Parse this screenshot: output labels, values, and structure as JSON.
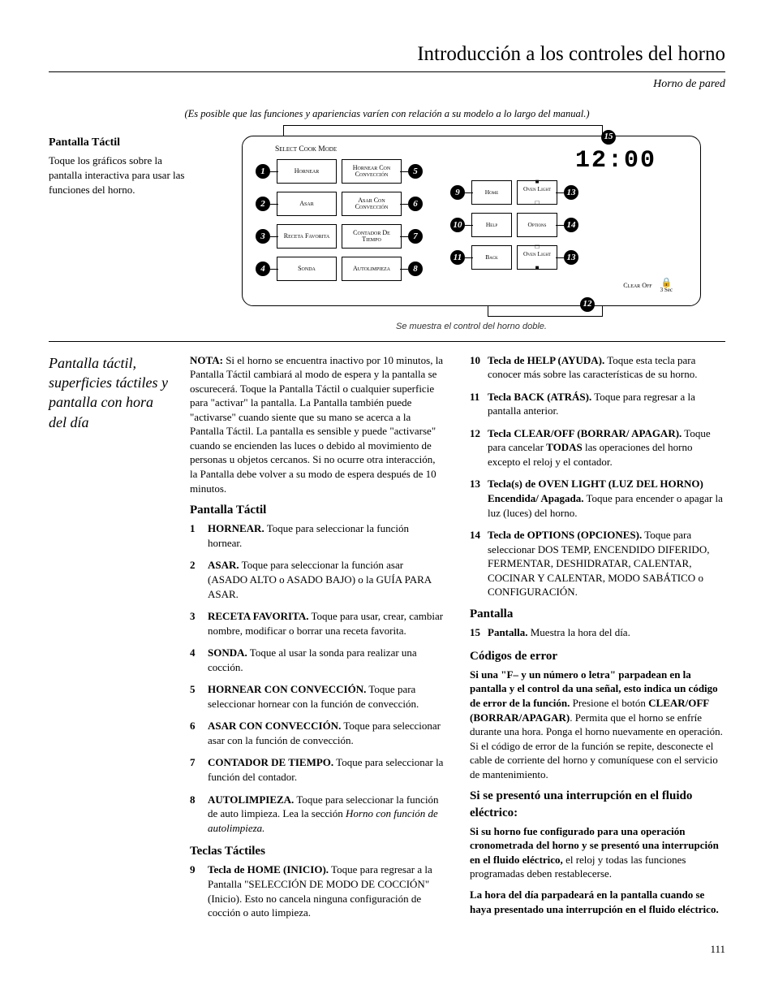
{
  "page_title": "Introducción a los controles del horno",
  "subtitle": "Horno de pared",
  "disclaimer": "(Es posible que las funciones y apariencias varíen con relación a su modelo a lo largo del manual.)",
  "intro": {
    "heading": "Pantalla Táctil",
    "body": "Toque los gráficos sobre la pantalla interactiva para usar las funciones del horno."
  },
  "diagram": {
    "select_cook_mode": "Select Cook Mode",
    "mode_buttons": [
      {
        "n": "1",
        "label": "Hornear"
      },
      {
        "n": "2",
        "label": "Asar"
      },
      {
        "n": "3",
        "label": "Receta Favorita"
      },
      {
        "n": "4",
        "label": "Sonda"
      },
      {
        "n": "5",
        "label": "Hornear Con Convección"
      },
      {
        "n": "6",
        "label": "Asar Con Convección"
      },
      {
        "n": "7",
        "label": "Contador De Tiempo"
      },
      {
        "n": "8",
        "label": "Autolimpieza"
      }
    ],
    "clock": "12:00",
    "keys": [
      {
        "n": "9",
        "label": "Home"
      },
      {
        "n": "10",
        "label": "Help"
      },
      {
        "n": "11",
        "label": "Back"
      },
      {
        "n": "13a",
        "label": "Oven Light",
        "on": true
      },
      {
        "n": "14",
        "label": "Options"
      },
      {
        "n": "13b",
        "label": "Oven Light",
        "on": false
      }
    ],
    "clear_off": "Clear Off",
    "lock_sec": "3 Sec",
    "callout_15": "15",
    "callout_12": "12",
    "caption": "Se muestra el control del horno doble."
  },
  "side_heading": "Pantalla táctil, superficies táctiles y pantalla con hora del día",
  "nota_label": "NOTA:",
  "nota_body": " Si el horno se encuentra inactivo por 10 minutos, la Pantalla Táctil cambiará al modo de espera y la pantalla se oscurecerá. Toque la Pantalla Táctil o cualquier superficie para \"activar\" la pantalla. La Pantalla también puede \"activarse\" cuando siente que su mano se acerca a la Pantalla Táctil. La pantalla es sensible y puede \"activarse\" cuando se encienden las luces o debido al movimiento de personas u objetos cercanos. Si no ocurre otra interacción, la Pantalla debe volver a su modo de espera después de 10 minutos.",
  "pt_heading": "Pantalla Táctil",
  "pt_items": [
    {
      "n": "1",
      "b": "HORNEAR.",
      "t": " Toque para seleccionar la función hornear."
    },
    {
      "n": "2",
      "b": "ASAR.",
      "t": " Toque para seleccionar la función asar (ASADO ALTO o ASADO BAJO) o la GUÍA PARA ASAR."
    },
    {
      "n": "3",
      "b": "RECETA FAVORITA.",
      "t": " Toque para usar, crear, cambiar nombre, modificar o borrar una receta favorita."
    },
    {
      "n": "4",
      "b": "SONDA.",
      "t": " Toque al usar la sonda para realizar una cocción."
    },
    {
      "n": "5",
      "b": "HORNEAR CON CONVECCIÓN.",
      "t": " Toque para seleccionar hornear con la función de convección."
    },
    {
      "n": "6",
      "b": "ASAR CON CONVECCIÓN.",
      "t": " Toque para seleccionar asar con la función de convección."
    },
    {
      "n": "7",
      "b": "CONTADOR DE TIEMPO.",
      "t": " Toque para seleccionar la función del contador."
    },
    {
      "n": "8",
      "b": "AUTOLIMPIEZA.",
      "t": " Toque para seleccionar la función de auto limpieza. Lea la sección ",
      "i": "Horno con función de autolimpieza."
    }
  ],
  "tt_heading": "Teclas Táctiles",
  "tt_items": [
    {
      "n": "9",
      "b": "Tecla de HOME (INICIO).",
      "t": " Toque para regresar a la Pantalla \"SELECCIÓN DE MODO DE COCCIÓN\" (Inicio). Esto no cancela ninguna configuración de cocción o auto limpieza."
    },
    {
      "n": "10",
      "b": "Tecla de HELP (AYUDA).",
      "t": " Toque esta tecla para conocer más sobre las características de su horno."
    },
    {
      "n": "11",
      "b": "Tecla BACK (ATRÁS).",
      "t": " Toque para regresar a la pantalla anterior."
    },
    {
      "n": "12",
      "b": "Tecla CLEAR/OFF (BORRAR/ APAGAR).",
      "t": " Toque para cancelar ",
      "b2": "TODAS",
      "t2": " las operaciones del horno excepto el reloj y el contador."
    },
    {
      "n": "13",
      "b": "Tecla(s) de OVEN LIGHT (LUZ DEL HORNO) Encendida/ Apagada.",
      "t": " Toque para encender o apagar la luz (luces) del horno."
    },
    {
      "n": "14",
      "b": "Tecla de OPTIONS (OPCIONES).",
      "t": " Toque para seleccionar DOS TEMP, ENCENDIDO DIFERIDO, FERMENTAR, DESHIDRATAR, CALENTAR, COCINAR Y CALENTAR, MODO SABÁTICO o CONFIGURACIÓN."
    }
  ],
  "pantalla_heading": "Pantalla",
  "pantalla_item": {
    "n": "15",
    "b": "Pantalla.",
    "t": " Muestra la hora del día."
  },
  "error_heading": "Códigos de error",
  "error_b1": "Si una \"F– y un número o letra\" parpadean en la pantalla y el control da una señal, esto indica un código de error de la función.",
  "error_t1": " Presione el botón ",
  "error_b2": "CLEAR/OFF (BORRAR/APAGAR)",
  "error_t2": ". Permita que el horno se enfríe durante una hora. Ponga el horno nuevamente en operación. Si el código de error de la función se repite, desconecte el cable de corriente del horno y comuníquese con el servicio de mantenimiento.",
  "power_heading": "Si se presentó una interrupción en el fluido eléctrico:",
  "power_b1": "Si su horno fue configurado para una operación cronometrada del horno y se presentó una interrupción en el fluido eléctrico,",
  "power_t1": " el reloj y todas las funciones programadas deben restablecerse.",
  "power_b2": "La hora del día parpadeará en la pantalla cuando se haya presentado una interrupción en el fluido eléctrico.",
  "page_num": "111"
}
